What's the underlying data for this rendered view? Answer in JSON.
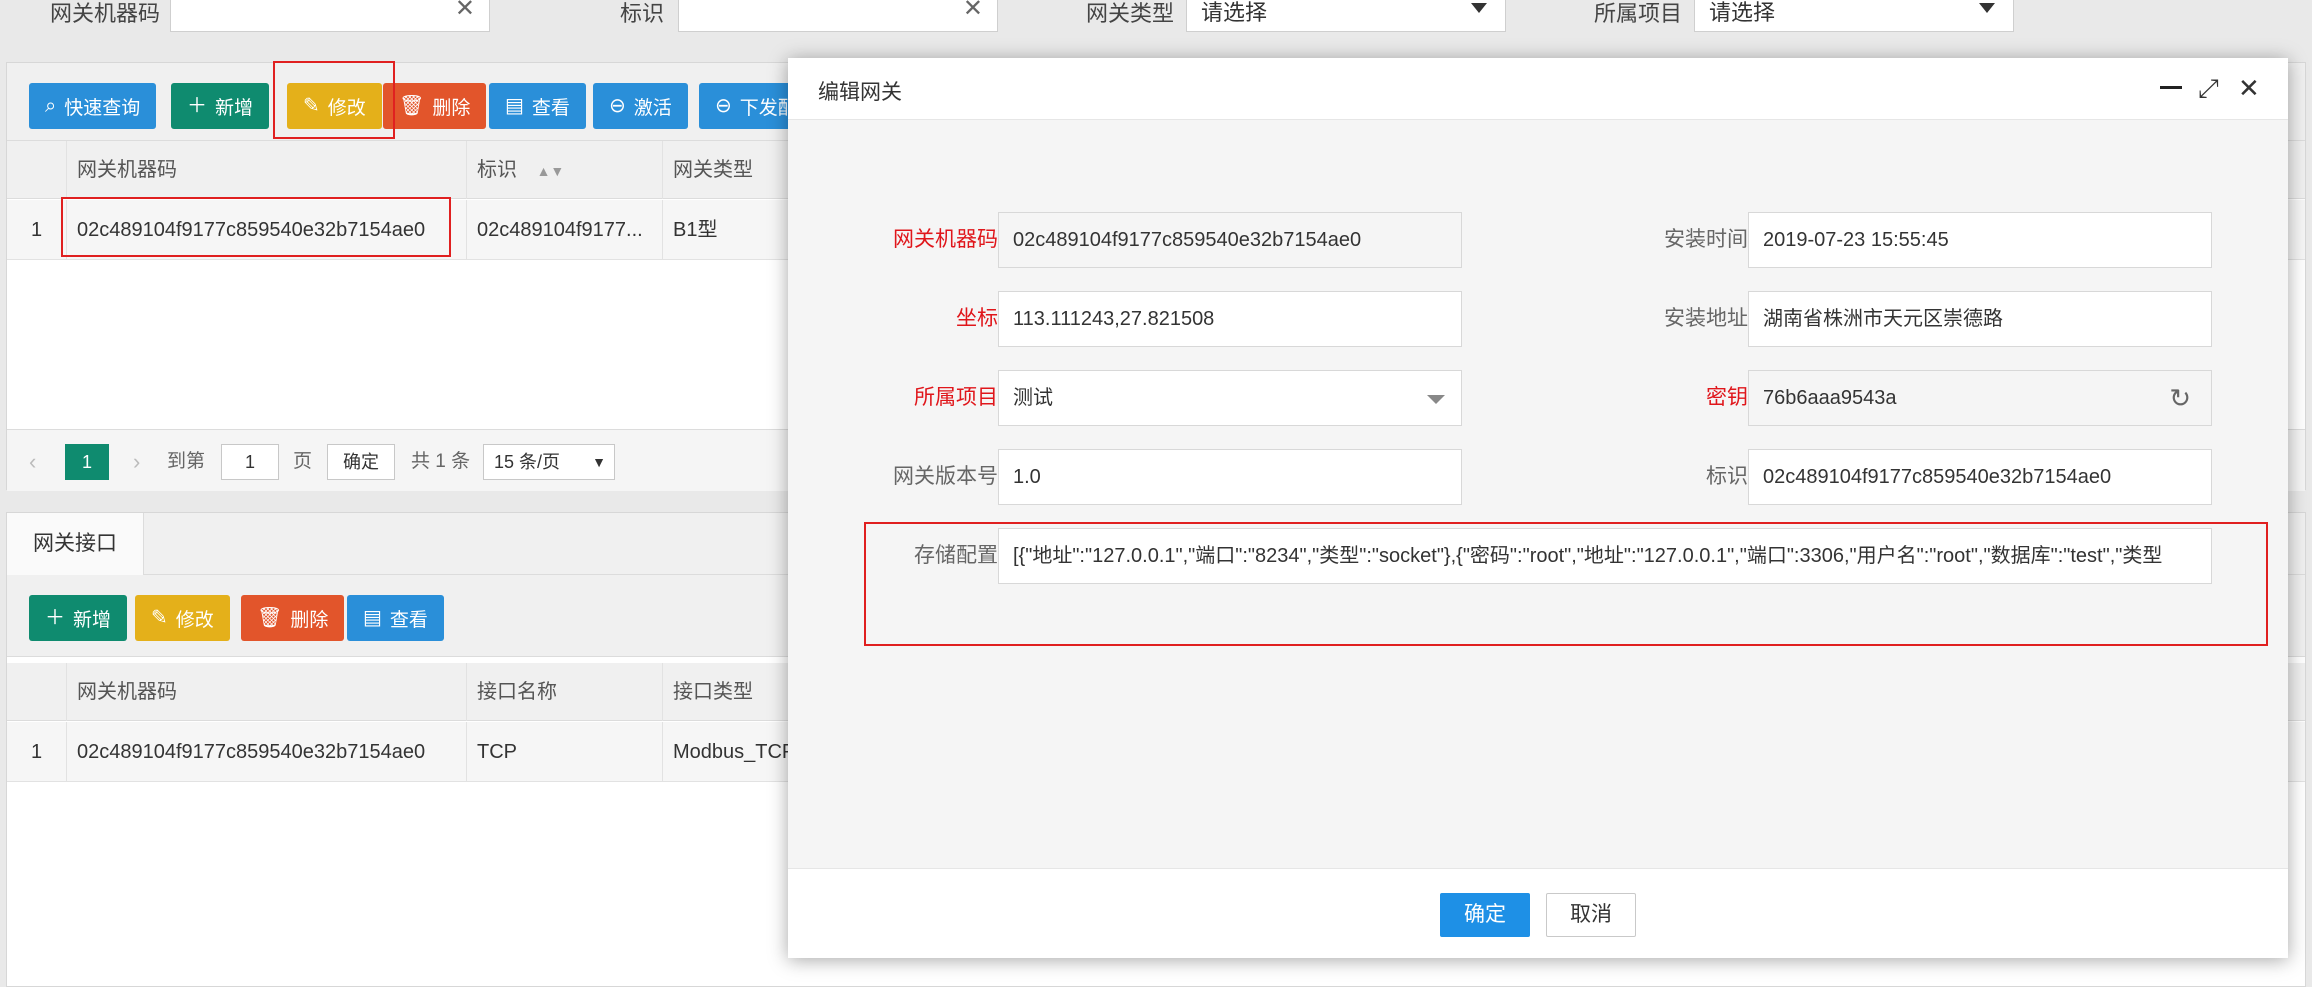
{
  "filters": {
    "gateway_code_label": "网关机器码",
    "mark_label": "标识",
    "gateway_type_label": "网关类型",
    "gateway_type_value": "请选择",
    "project_label": "所属项目",
    "project_value": "请选择",
    "clear_glyph": "✕"
  },
  "main_toolbar": {
    "quick_query": "快速查询",
    "add": "新增",
    "edit": "修改",
    "delete": "删除",
    "view": "查看",
    "activate": "激活",
    "dispatch": "下发配"
  },
  "gateway_grid": {
    "columns": [
      "网关机器码",
      "标识",
      "网关类型"
    ],
    "rows": [
      {
        "index": "1",
        "code": "02c489104f9177c859540e32b7154ae0",
        "mark": "02c489104f9177...",
        "type": "B1型"
      }
    ]
  },
  "pager": {
    "current_page": "1",
    "goto_label": "到第",
    "goto_value": "1",
    "page_unit": "页",
    "confirm": "确定",
    "total": "共 1 条",
    "page_size": "15 条/页"
  },
  "interface_panel": {
    "tab_label": "网关接口",
    "toolbar": {
      "add": "新增",
      "edit": "修改",
      "delete": "删除",
      "view": "查看"
    },
    "columns": [
      "网关机器码",
      "接口名称",
      "接口类型"
    ],
    "rows": [
      {
        "index": "1",
        "code": "02c489104f9177c859540e32b7154ae0",
        "name": "TCP",
        "type": "Modbus_TCP"
      }
    ]
  },
  "modal": {
    "title": "编辑网关",
    "fields": {
      "gateway_code_label": "网关机器码",
      "gateway_code_value": "02c489104f9177c859540e32b7154ae0",
      "install_time_label": "安装时间",
      "install_time_value": "2019-07-23 15:55:45",
      "coord_label": "坐标",
      "coord_value": "113.111243,27.821508",
      "install_addr_label": "安装地址",
      "install_addr_value": "湖南省株洲市天元区崇德路",
      "project_label": "所属项目",
      "project_value": "测试",
      "secret_label": "密钥",
      "secret_value": "76b6aaa9543a",
      "version_label": "网关版本号",
      "version_value": "1.0",
      "mark_label": "标识",
      "mark_value": "02c489104f9177c859540e32b7154ae0",
      "storage_label": "存储配置",
      "storage_value": "[{\"地址\":\"127.0.0.1\",\"端口\":\"8234\",\"类型\":\"socket\"},{\"密码\":\"root\",\"地址\":\"127.0.0.1\",\"端口\":3306,\"用户名\":\"root\",\"数据库\":\"test\",\"类型"
    },
    "ok": "确定",
    "cancel": "取消"
  }
}
